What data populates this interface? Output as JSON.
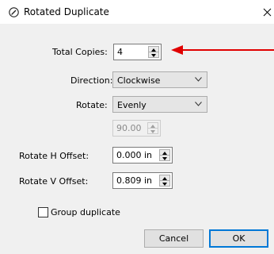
{
  "window": {
    "title": "Rotated Duplicate",
    "close_glyph": "✕",
    "title_icon": "pen-circle-icon"
  },
  "form": {
    "total_copies_label": "Total Copies:",
    "total_copies_value": "4",
    "direction_label": "Direction:",
    "direction_value": "Clockwise",
    "rotate_label": "Rotate:",
    "rotate_value": "Evenly",
    "angle_value": "90.00",
    "h_offset_label": "Rotate H Offset:",
    "h_offset_value": "0.000 in",
    "v_offset_label": "Rotate V Offset:",
    "v_offset_value": "0.809 in",
    "group_label": "Group duplicate",
    "group_checked": false
  },
  "buttons": {
    "cancel": "Cancel",
    "ok": "OK"
  },
  "colors": {
    "arrow": "#e00000",
    "accent": "#0078d7"
  }
}
